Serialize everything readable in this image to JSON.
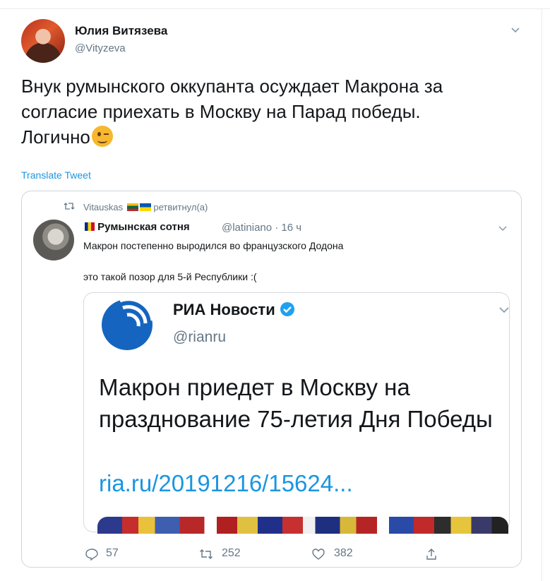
{
  "tweet": {
    "author_name": "Юлия Витязева",
    "author_handle": "@Vityzeva",
    "text_line1": "Внук румынского оккупанта осуждает Макрона за",
    "text_line2": "согласие приехать в Москву на Парад победы.",
    "text_line3": "Логично",
    "emoji": "winking-face-emoji",
    "translate_label": "Translate Tweet"
  },
  "quoted": {
    "retweeted_by": "Vitauskas",
    "retweeted_suffix": "ретвитнул(а)",
    "author_name": "Румынская сотня",
    "author_handle_time": "@latiniano · 16 ч",
    "line1": "Макрон постепенно выродился во французского Додона",
    "line2": "это такой позор для 5-й Республики :(",
    "image": {
      "source_name": "РИА Новости",
      "source_handle": "@rianru",
      "headline": "Макрон приедет в Москву на празднование 75-летия Дня Победы",
      "link": "ria.ru/20191216/15624..."
    },
    "stats": {
      "replies": "57",
      "retweets": "252",
      "likes": "382"
    }
  },
  "colors": {
    "accent": "#1b95e0",
    "muted": "#657786",
    "text": "#14171a",
    "border": "#ccd6dd"
  }
}
